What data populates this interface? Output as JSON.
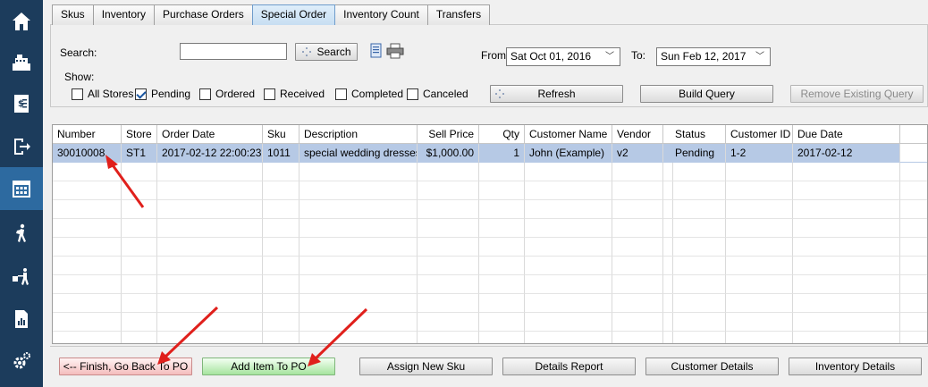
{
  "tabs": [
    "Skus",
    "Inventory",
    "Purchase Orders",
    "Special Order",
    "Inventory Count",
    "Transfers"
  ],
  "search": {
    "label": "Search:",
    "value": "",
    "button_label": "Search"
  },
  "date_range": {
    "from_label": "From:",
    "from_value": "Sat  Oct  01, 2016",
    "to_label": "To:",
    "to_value": "Sun  Feb  12, 2017"
  },
  "show": {
    "label": "Show:",
    "options": [
      {
        "label": "All Stores",
        "checked": false
      },
      {
        "label": "Pending",
        "checked": true
      },
      {
        "label": "Ordered",
        "checked": false
      },
      {
        "label": "Received",
        "checked": false
      },
      {
        "label": "Completed",
        "checked": false
      },
      {
        "label": "Canceled",
        "checked": false
      }
    ]
  },
  "buttons": {
    "refresh": "Refresh",
    "build_query": "Build Query",
    "remove_query": "Remove Existing Query"
  },
  "grid": {
    "columns": [
      "Number",
      "Store",
      "Order Date",
      "Sku",
      "Description",
      "Sell Price",
      "Qty",
      "Customer Name",
      "Vendor",
      "",
      "Status",
      "Customer ID",
      "Due Date"
    ],
    "rows": [
      [
        "30010008",
        "ST1",
        "2017-02-12 22:00:23",
        "1011",
        "special wedding dresses",
        "$1,000.00",
        "1",
        "John (Example)",
        "v2",
        "",
        "Pending",
        "1-2",
        "2017-02-12"
      ]
    ]
  },
  "bottom_buttons": {
    "finish": "<-- Finish, Go Back To PO",
    "add_item": "Add Item To PO",
    "assign_sku": "Assign New Sku",
    "details_report": "Details Report",
    "customer_details": "Customer Details",
    "inventory_details": "Inventory Details"
  },
  "nav_icons": [
    "home-icon",
    "cash-register-icon",
    "invoice-icon",
    "sign-out-icon",
    "calendar-grid-icon",
    "hiker-icon",
    "delivery-icon",
    "report-icon",
    "settings-icon"
  ],
  "colors": {
    "nav_bg": "#1c3c5c",
    "nav_active": "#2d6aa0",
    "selection": "#b6c9e5",
    "annotation_arrow": "#e0201c"
  }
}
